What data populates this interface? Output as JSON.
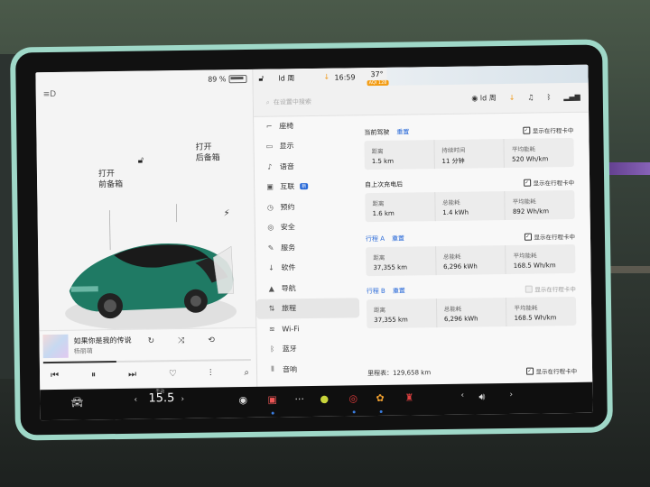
{
  "status_bar": {
    "battery_percent": "89 %",
    "user": "ld 周",
    "time": "16:59",
    "temperature": "37°",
    "aqi": "AQI 128"
  },
  "car": {
    "front_trunk": {
      "line1": "打开",
      "line2": "前备箱"
    },
    "rear_trunk": {
      "line1": "打开",
      "line2": "后备箱"
    },
    "body_color": "#1f7a64"
  },
  "media": {
    "song": "如果你是我的传说",
    "artist": "杨丽萌",
    "progress": 0.35
  },
  "settings": {
    "search_placeholder": "在设置中搜索",
    "user": "ld 周",
    "menu": [
      {
        "label": "座椅",
        "icon": "seat-icon",
        "glyph": "⌐"
      },
      {
        "label": "显示",
        "icon": "display-icon",
        "glyph": "▭"
      },
      {
        "label": "语音",
        "icon": "mic-icon",
        "glyph": "♪"
      },
      {
        "label": "互联",
        "icon": "connect-icon",
        "glyph": "▣",
        "badge": "新"
      },
      {
        "label": "预约",
        "icon": "clock-icon",
        "glyph": "◷"
      },
      {
        "label": "安全",
        "icon": "safety-icon",
        "glyph": "◎"
      },
      {
        "label": "服务",
        "icon": "wrench-icon",
        "glyph": "✎"
      },
      {
        "label": "软件",
        "icon": "download-icon",
        "glyph": "↓"
      },
      {
        "label": "导航",
        "icon": "nav-icon",
        "glyph": "▲"
      },
      {
        "label": "旅程",
        "icon": "trip-icon",
        "glyph": "⇅",
        "active": true
      },
      {
        "label": "Wi-Fi",
        "icon": "wifi-icon",
        "glyph": "≋"
      },
      {
        "label": "蓝牙",
        "icon": "bluetooth-icon",
        "glyph": "ᛒ"
      },
      {
        "label": "音响",
        "icon": "audio-icon",
        "glyph": "⦀"
      }
    ],
    "trips": [
      {
        "title": "当前驾驶",
        "reset": "重置",
        "title_blue": false,
        "show_label": "显示在行程卡中",
        "checked": true,
        "stats": [
          {
            "label": "距离",
            "value": "1.5 km"
          },
          {
            "label": "持续时间",
            "value": "11 分钟"
          },
          {
            "label": "平均能耗",
            "value": "520 Wh/km"
          }
        ]
      },
      {
        "title": "自上次充电后",
        "reset": "",
        "title_blue": false,
        "show_label": "显示在行程卡中",
        "checked": true,
        "stats": [
          {
            "label": "距离",
            "value": "1.6 km"
          },
          {
            "label": "总能耗",
            "value": "1.4 kWh"
          },
          {
            "label": "平均能耗",
            "value": "892 Wh/km"
          }
        ]
      },
      {
        "title": "行程 A",
        "reset": "重置",
        "title_blue": true,
        "show_label": "显示在行程卡中",
        "checked": true,
        "stats": [
          {
            "label": "距离",
            "value": "37,355 km"
          },
          {
            "label": "总能耗",
            "value": "6,296 kWh"
          },
          {
            "label": "平均能耗",
            "value": "168.5 Wh/km"
          }
        ]
      },
      {
        "title": "行程 B",
        "reset": "重置",
        "title_blue": true,
        "show_label": "显示在行程卡中",
        "checked": false,
        "stats": [
          {
            "label": "距离",
            "value": "37,355 km"
          },
          {
            "label": "总能耗",
            "value": "6,296 kWh"
          },
          {
            "label": "平均能耗",
            "value": "168.5 Wh/km"
          }
        ]
      }
    ],
    "odometer": {
      "label": "里程表：129,658 km",
      "show_label": "显示在行程卡中",
      "checked": true
    }
  },
  "taskbar": {
    "speed": "15.5",
    "speed_label": "手动"
  },
  "colors": {
    "accent_blue": "#2a6ad8",
    "bezel": "#9fd8c8",
    "download_orange": "#f09a1a"
  }
}
